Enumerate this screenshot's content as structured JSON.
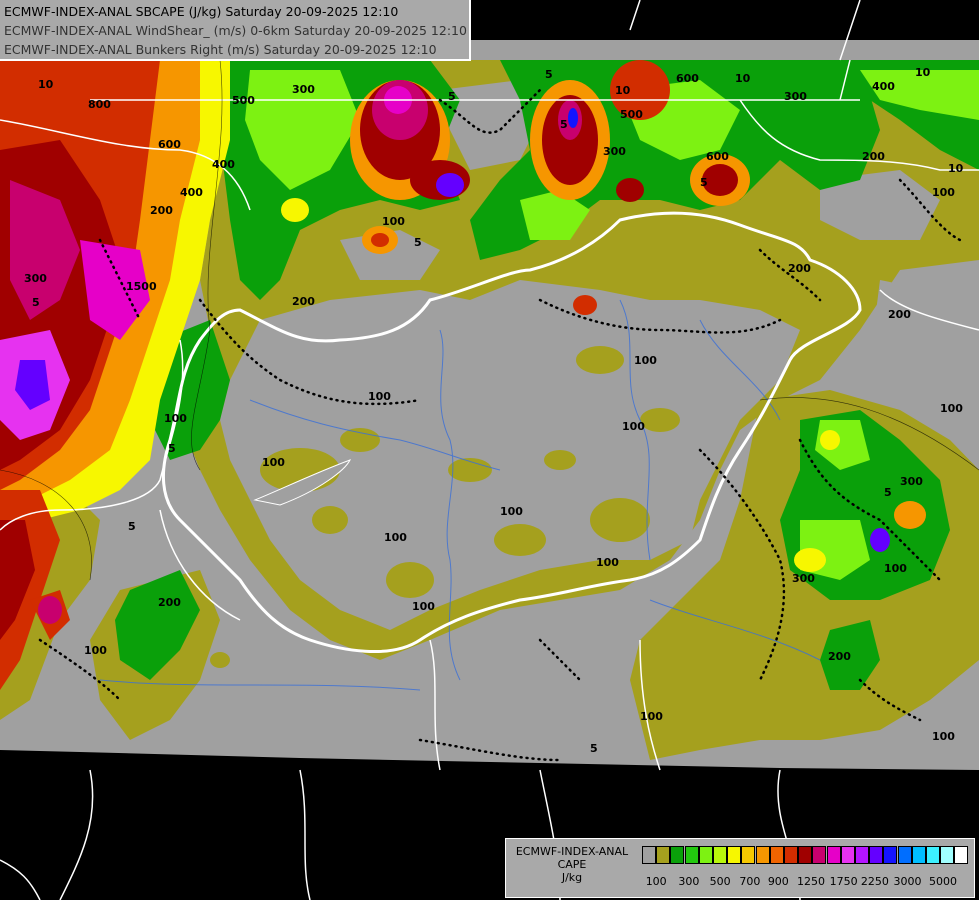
{
  "header": {
    "lines": [
      "ECMWF-INDEX-ANAL SBCAPE (J/kg) Saturday 20-09-2025 12:10",
      "ECMWF-INDEX-ANAL WindShear_ (m/s) 0-6km Saturday 20-09-2025 12:10",
      "ECMWF-INDEX-ANAL Bunkers Right (m/s) Saturday 20-09-2025 12:10"
    ]
  },
  "legend": {
    "title_lines": [
      "ECMWF-INDEX-ANAL",
      "CAPE",
      "J/kg"
    ],
    "colors": [
      "#a0a0a0",
      "#a5a01e",
      "#0aa00a",
      "#22c80f",
      "#7df212",
      "#b9f70c",
      "#f7f700",
      "#f6c800",
      "#f69600",
      "#f06400",
      "#d22d00",
      "#a00000",
      "#c8006e",
      "#e600c8",
      "#e632f0",
      "#b414ff",
      "#6400ff",
      "#1414ff",
      "#006eff",
      "#00beff",
      "#3cf0ff",
      "#a0ffff",
      "#ffffff"
    ],
    "ticks": [
      "100",
      "300",
      "500",
      "700",
      "900",
      "1250",
      "1750",
      "2250",
      "3000",
      "5000"
    ]
  },
  "map_labels": {
    "cape": [
      "800",
      "500",
      "600",
      "400",
      "200",
      "300",
      "100",
      "600",
      "300",
      "600",
      "200",
      "300",
      "500",
      "400",
      "200",
      "100",
      "100",
      "100",
      "100",
      "100",
      "100",
      "100",
      "100",
      "100",
      "200",
      "300",
      "100",
      "200",
      "100",
      "100",
      "300",
      "200",
      "300",
      "100",
      "400",
      "200",
      "100",
      "1500",
      "100"
    ],
    "shear": [
      "10",
      "5",
      "5",
      "10",
      "10",
      "10",
      "10",
      "5",
      "5",
      "5",
      "5",
      "5",
      "5",
      "5",
      "5"
    ]
  }
}
